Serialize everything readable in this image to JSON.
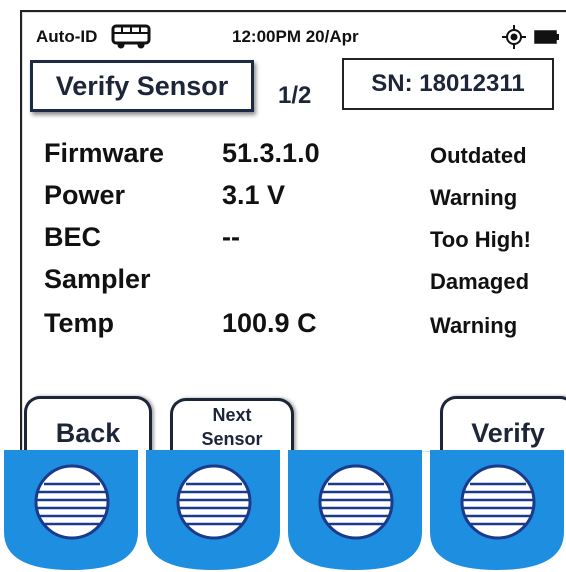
{
  "status_bar": {
    "app_name": "Auto-ID",
    "clock": "12:00PM 20/Apr",
    "icons": [
      "bus-icon",
      "gps-locate-icon",
      "battery-icon"
    ]
  },
  "header": {
    "title": "Verify Sensor",
    "page_indicator": "1/2",
    "serial": "SN: 18012311"
  },
  "readings": [
    {
      "label": "Firmware",
      "value": "51.3.1.0",
      "status": "Outdated"
    },
    {
      "label": "Power",
      "value": "3.1 V",
      "status": "Warning"
    },
    {
      "label": "BEC",
      "value": "--",
      "status": "Too High!"
    },
    {
      "label": "Sampler",
      "value": "",
      "status": "Damaged"
    },
    {
      "label": "Temp",
      "value": "100.9 C",
      "status": "Warning"
    }
  ],
  "softkeys": {
    "back": "Back",
    "next_line1": "Next",
    "next_line2": "Sensor",
    "verify": "Verify"
  },
  "colors": {
    "hardware_button": "#1e8fe0",
    "text_dark": "#1d2538"
  }
}
